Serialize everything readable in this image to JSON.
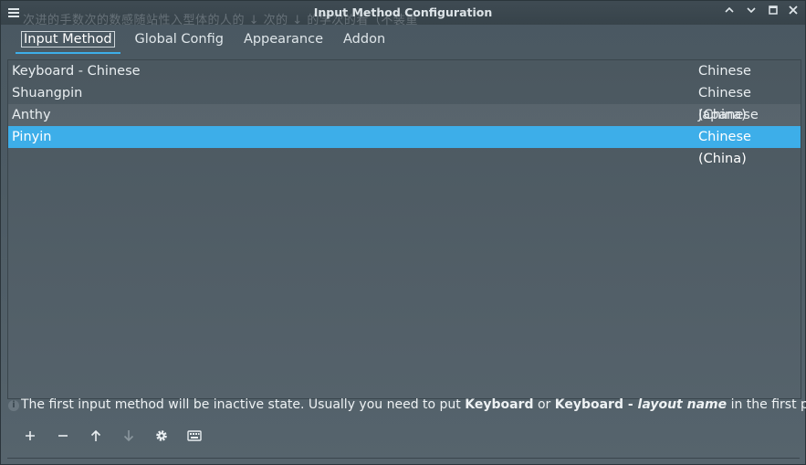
{
  "window": {
    "title": "Input Method Configuration",
    "ghost_text": "次进的手数次的数感随站性入型体的人的 ↓ 次的 ↓ 的学次的看（不装重"
  },
  "tabs": [
    {
      "label": "Input Method",
      "active": true
    },
    {
      "label": "Global Config",
      "active": false
    },
    {
      "label": "Appearance",
      "active": false
    },
    {
      "label": "Addon",
      "active": false
    }
  ],
  "input_methods": [
    {
      "name": "Keyboard - Chinese",
      "language": "Chinese",
      "selected": false
    },
    {
      "name": "Shuangpin",
      "language": "Chinese (China)",
      "selected": false
    },
    {
      "name": "Anthy",
      "language": "Japanese",
      "selected": false
    },
    {
      "name": "Pinyin",
      "language": "Chinese (China)",
      "selected": true
    }
  ],
  "hint": {
    "prefix": "The first input method will be inactive state. Usually you need to put ",
    "kbd1": "Keyboard",
    "mid": " or ",
    "kbd2": "Keyboard - ",
    "layout": "layout name",
    "suffix": " in the first place."
  },
  "toolbar": {
    "add_icon": "plus-icon",
    "remove_icon": "minus-icon",
    "up_icon": "arrow-up-icon",
    "down_icon": "arrow-down-icon",
    "configure_icon": "gear-icon",
    "keyboard_icon": "keyboard-icon"
  },
  "colors": {
    "selection": "#3daee9",
    "background": "#4d5b64"
  }
}
